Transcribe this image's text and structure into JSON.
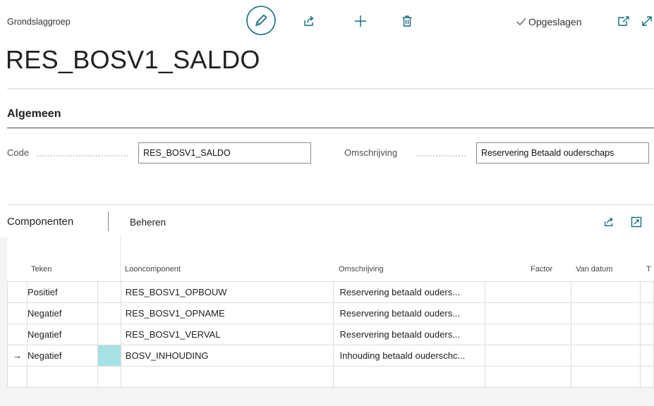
{
  "header": {
    "kicker": "Grondslaggroep",
    "title": "RES_BOSV1_SALDO",
    "saved_status": "Opgeslagen"
  },
  "colors": {
    "accent": "#0f6b7a",
    "link": "#0f7a8a",
    "selection": "#a6e1e6"
  },
  "general": {
    "section_title": "Algemeen",
    "code_label": "Code",
    "code_value": "RES_BOSV1_SALDO",
    "description_label": "Omschrijving",
    "description_value": "Reservering Betaald ouderschaps"
  },
  "components": {
    "tab_label": "Componenten",
    "action_label": "Beheren",
    "columns": {
      "teken": "Teken",
      "looncomponent": "Looncomponent",
      "omschrijving": "Omschrijving",
      "factor": "Factor",
      "van_datum": "Van datum",
      "truncated": "T"
    },
    "rows": [
      {
        "teken": "Positief",
        "looncomponent": "RES_BOSV1_OPBOUW",
        "omschrijving": "Reservering betaald ouders...",
        "current": ""
      },
      {
        "teken": "Negatief",
        "looncomponent": "RES_BOSV1_OPNAME",
        "omschrijving": "Reservering betaald ouders...",
        "current": ""
      },
      {
        "teken": "Negatief",
        "looncomponent": "RES_BOSV1_VERVAL",
        "omschrijving": "Reservering betaald ouders...",
        "current": ""
      },
      {
        "teken": "Negatief",
        "looncomponent": "BOSV_INHOUDING",
        "omschrijving": "Inhouding betaald ouderschc...",
        "current": "→"
      }
    ]
  }
}
